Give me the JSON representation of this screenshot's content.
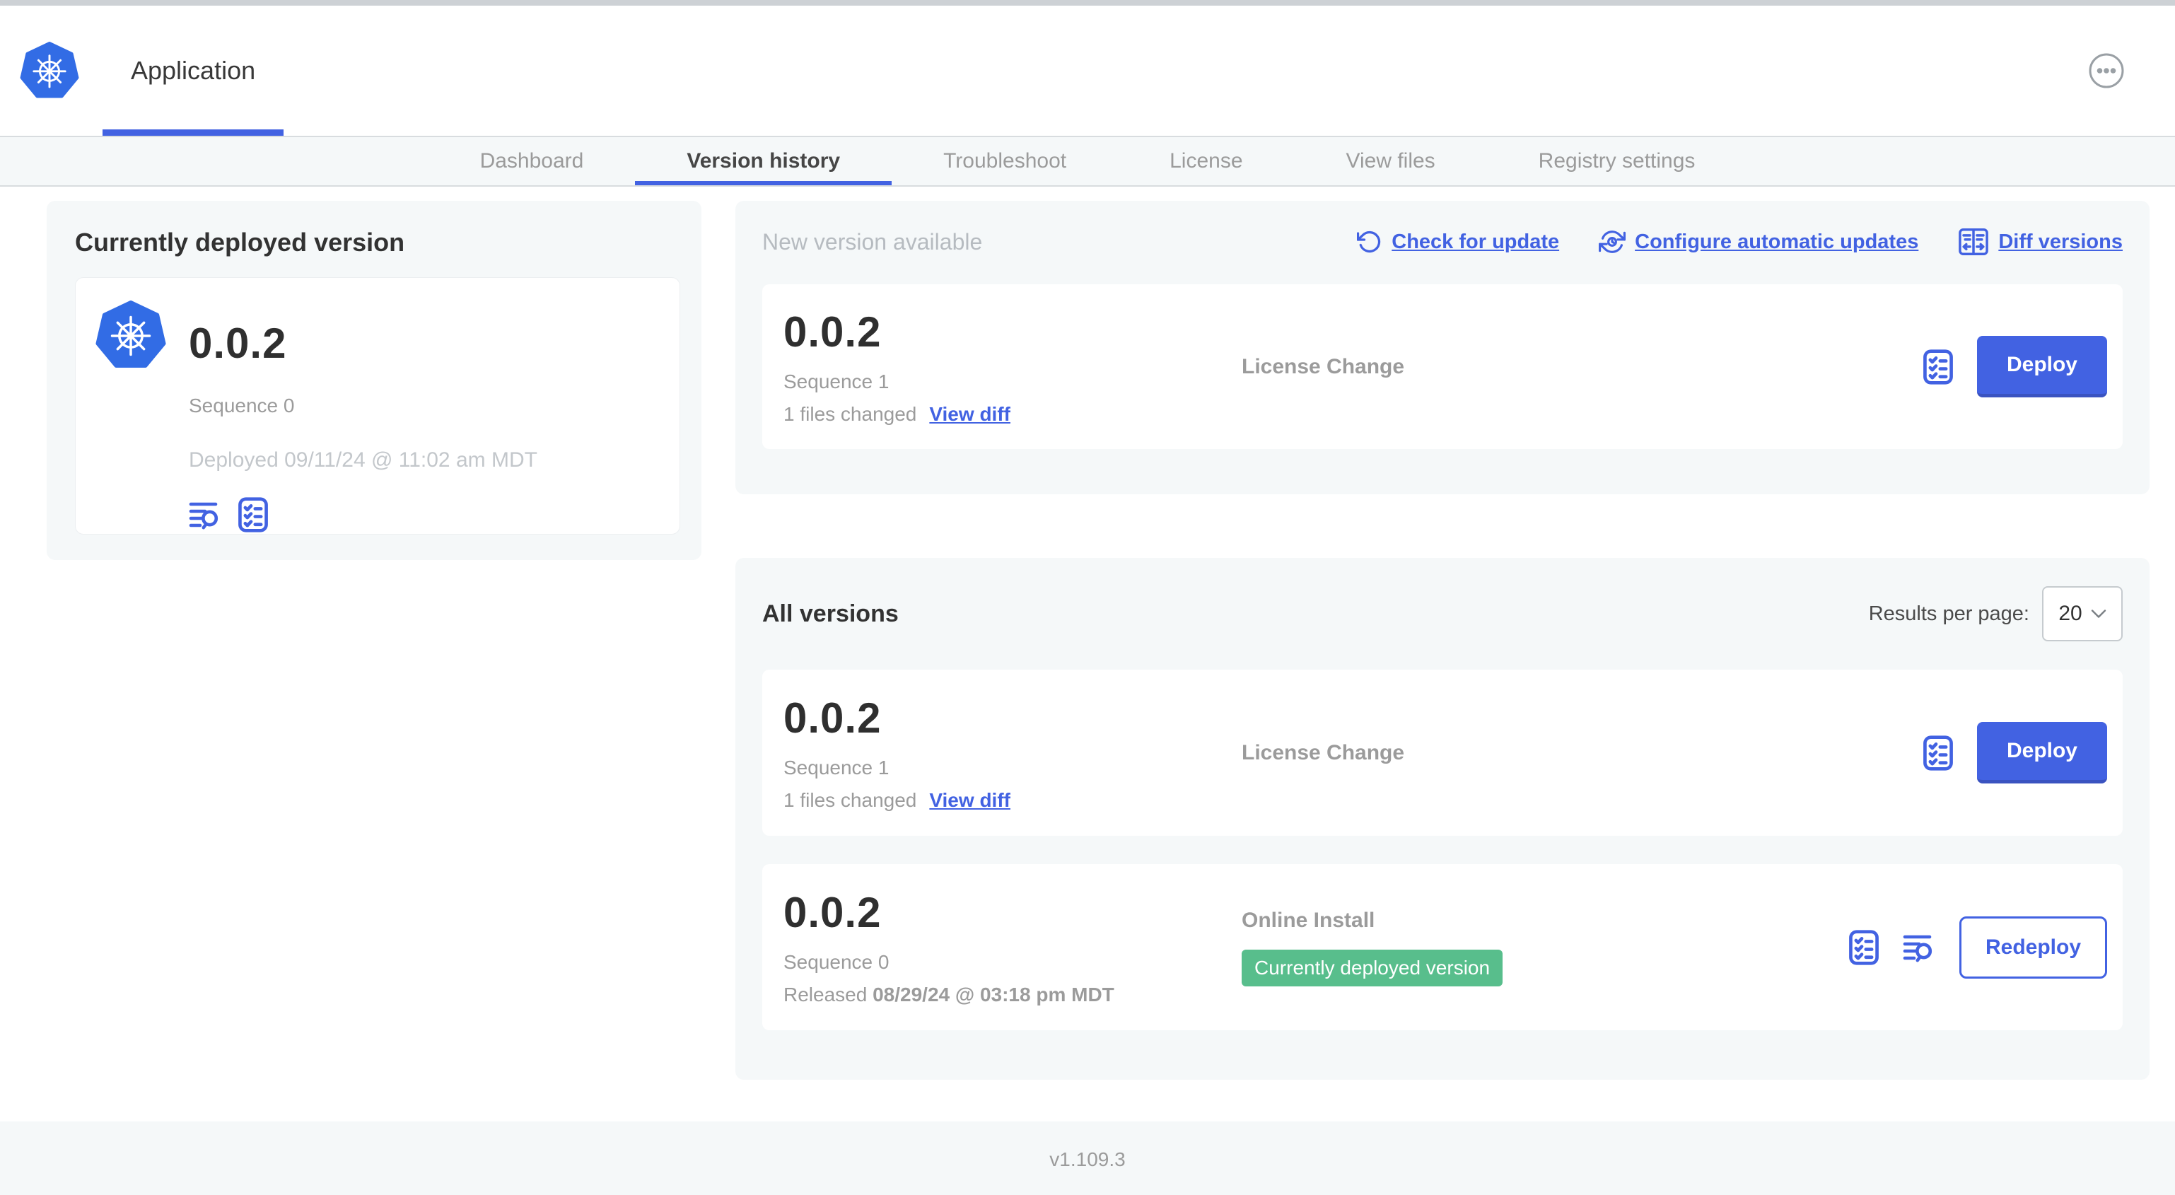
{
  "header": {
    "title": "Application"
  },
  "nav_tabs": {
    "items": [
      {
        "label": "Dashboard",
        "active": false
      },
      {
        "label": "Version history",
        "active": true
      },
      {
        "label": "Troubleshoot",
        "active": false
      },
      {
        "label": "License",
        "active": false
      },
      {
        "label": "View files",
        "active": false
      },
      {
        "label": "Registry settings",
        "active": false
      }
    ]
  },
  "current_version_panel": {
    "title": "Currently deployed version",
    "version": "0.0.2",
    "sequence": "Sequence 0",
    "deployed": "Deployed 09/11/24 @ 11:02 am MDT",
    "icons": [
      "logs-icon",
      "checklist-icon"
    ]
  },
  "new_version_panel": {
    "label": "New version available",
    "actions": {
      "check_for_update": "Check for update",
      "configure_automatic_updates": "Configure automatic updates",
      "diff_versions": "Diff versions"
    },
    "card": {
      "version": "0.0.2",
      "sequence": "Sequence 1",
      "files_changed": "1 files changed",
      "view_diff": "View diff",
      "source": "License Change",
      "deploy_label": "Deploy"
    }
  },
  "all_versions_panel": {
    "title": "All versions",
    "results_per_page_label": "Results per page:",
    "results_per_page_value": "20",
    "rows": [
      {
        "version": "0.0.2",
        "sequence": "Sequence 1",
        "files_changed": "1 files changed",
        "view_diff": "View diff",
        "source": "License Change",
        "action_label": "Deploy"
      },
      {
        "version": "0.0.2",
        "sequence": "Sequence 0",
        "released_prefix": "Released",
        "released_date": "08/29/24 @ 03:18 pm MDT",
        "source": "Online Install",
        "status_badge": "Currently deployed version",
        "action_label": "Redeploy"
      }
    ]
  },
  "footer": {
    "version": "v1.109.3"
  },
  "colors": {
    "accent_blue": "#4262E2",
    "kubernetes_blue": "#326CE5",
    "badge_green": "#58BE8C",
    "panel_background": "#F5F8F9"
  }
}
